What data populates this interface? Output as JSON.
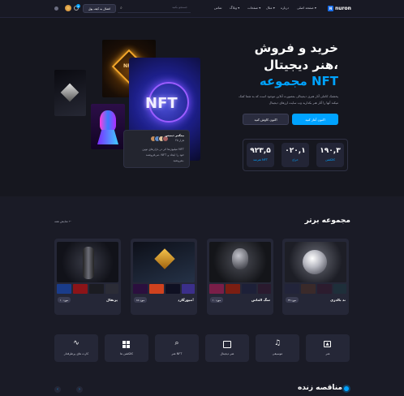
{
  "header": {
    "logo_text": "nuron",
    "nav": [
      {
        "label": "صفحه اصلی",
        "has_dropdown": true
      },
      {
        "label": "درباره",
        "has_dropdown": false
      },
      {
        "label": "مثال",
        "has_dropdown": true
      },
      {
        "label": "صفحات",
        "has_dropdown": true
      },
      {
        "label": "وبلاگ",
        "has_dropdown": true
      },
      {
        "label": "تماس",
        "has_dropdown": false
      }
    ],
    "search_placeholder": "جستجو بکنید",
    "wallet_button": "اتصال به کیف پول",
    "notification_count": "6"
  },
  "hero": {
    "title_line1": "خرید و فروش",
    "title_line2": "هنر دیجیتال،",
    "title_line3": "مجموعه NFT",
    "description_line1": "پخشنک کاملی آثار هنری دیجیتالی بمصورت آنلاین موجود است که به شما کمک",
    "description_line2": "میکند آنها را آثار هنر بکدارید وب سایت ارزهای دیجیتال",
    "btn_primary": "اکنون آغاز کنید",
    "btn_secondary": "اکنون کاوش کنید",
    "stats": [
      {
        "value": "۱۹۰,۳",
        "label": "کالکشن"
      },
      {
        "value": "۰۲۰,۱",
        "label": "حراج"
      },
      {
        "value": "۹۲۳,۵",
        "label": "هنرمند NFT"
      }
    ],
    "preview": {
      "artist_name": "بیتکمر دینیس",
      "artist_meta": "۳۵ هزار",
      "text_line1": "میلیون‌ها اثر در بازارهای نوین NFT",
      "text_line2": "می‌فروشند. NFT خود را ایجاد و",
      "text_line3": "بفروشید.",
      "nft_label": "NFT"
    }
  },
  "collection": {
    "title": "مجموعه برتر",
    "view_all": "نمایش همه",
    "items": [
      {
        "name": "ند بالدری",
        "count": "۲۷ مورد",
        "accent": "#cfd0d8"
      },
      {
        "name": "سگ الماس",
        "count": "۱۰ مورد",
        "accent": "#8a8c96"
      },
      {
        "name": "میوزگارد!",
        "count": "۱۵ مورد",
        "accent": "#e7b340"
      },
      {
        "name": "پرتقال",
        "count": "۱۰ مورد",
        "accent": "#6a6c80"
      }
    ]
  },
  "categories": [
    {
      "label": "هنر",
      "icon": "image-icon"
    },
    {
      "label": "موسیقی",
      "icon": "music-icon"
    },
    {
      "label": "هنر دیجیتال",
      "icon": "map-icon"
    },
    {
      "label": "هنر NFT",
      "icon": "search-icon"
    },
    {
      "label": "کالکشن ها",
      "icon": "grid-icon"
    },
    {
      "label": "کارت های پرطرفدار",
      "icon": "activity-icon"
    }
  ],
  "live": {
    "title": "مناقصه زنده"
  },
  "colors": {
    "accent": "#00a3ff",
    "background": "#1a1b26",
    "card": "#252737"
  }
}
